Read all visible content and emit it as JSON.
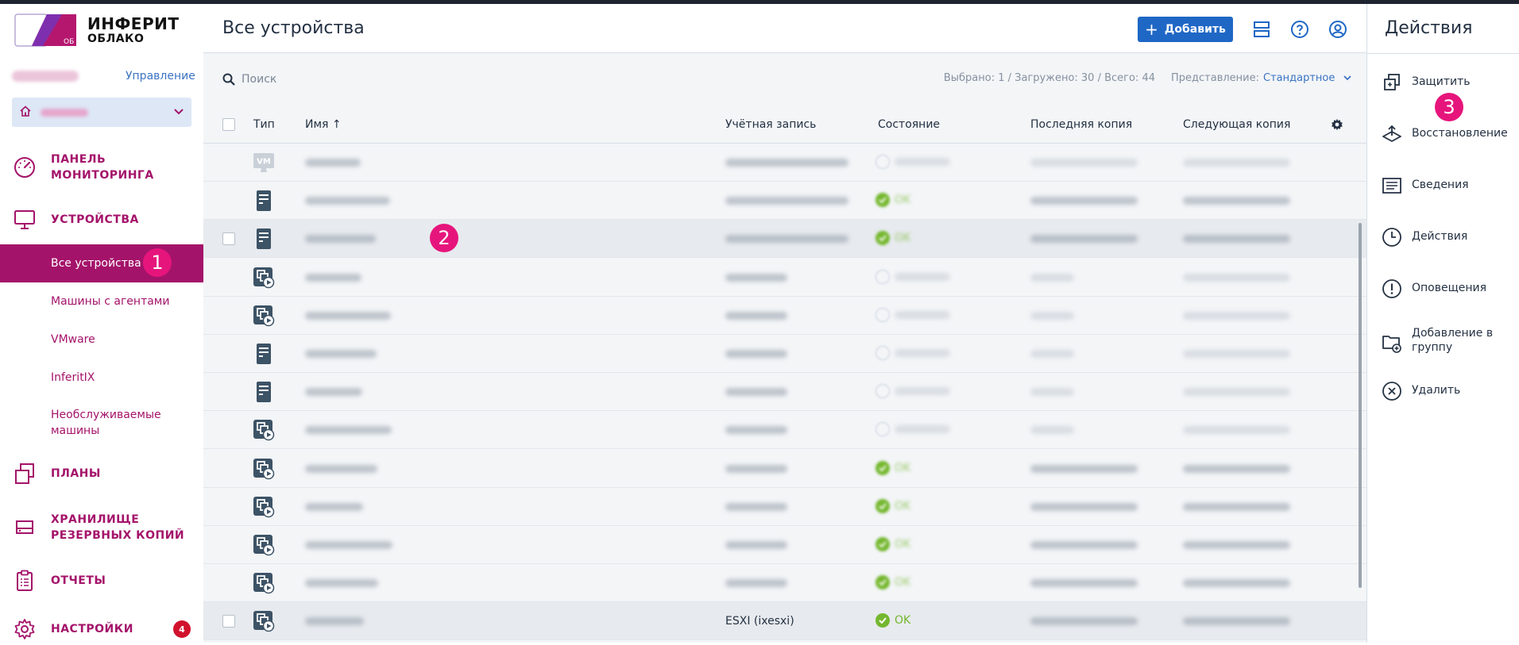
{
  "brand": {
    "logo_badge": "ОБ",
    "name_line1": "ИНФЕРИТ",
    "name_line2": "ОБЛАКО",
    "accent_color": "#a4136a",
    "primary_color": "#1f67c5"
  },
  "sidebar": {
    "client_name": "",
    "manage_label": "Управление",
    "tenant_selected": "",
    "nav": [
      {
        "id": "dashboard",
        "label": "ПАНЕЛЬ МОНИТОРИНГА",
        "icon": "speedometer-icon"
      },
      {
        "id": "devices",
        "label": "УСТРОЙСТВА",
        "icon": "monitor-icon"
      },
      {
        "id": "plans",
        "label": "ПЛАНЫ",
        "icon": "plans-icon"
      },
      {
        "id": "storage",
        "label": "ХРАНИЛИЩЕ РЕЗЕРВНЫХ КОПИЙ",
        "icon": "storage-icon"
      },
      {
        "id": "reports",
        "label": "ОТЧЕТЫ",
        "icon": "clipboard-icon"
      },
      {
        "id": "settings",
        "label": "НАСТРОЙКИ",
        "icon": "gear-icon",
        "badge": "4"
      }
    ],
    "device_subitems": [
      {
        "label": "Все устройства",
        "active": true
      },
      {
        "label": "Машины с агентами",
        "active": false
      },
      {
        "label": "VMware",
        "active": false
      },
      {
        "label": "InferitIX",
        "active": false
      },
      {
        "label": "Необслуживаемые машины",
        "active": false
      }
    ]
  },
  "header": {
    "title": "Все устройства",
    "add_label": "Добавить"
  },
  "toolbar": {
    "search_placeholder": "Поиск",
    "counts": "Выбрано: 1 / Загружено: 30 / Всего: 44",
    "view_label": "Представление:",
    "view_value": "Стандартное"
  },
  "table": {
    "columns": {
      "type": "Тип",
      "name": "Имя ↑",
      "account": "Учётная запись",
      "state": "Состояние",
      "last_backup": "Последняя копия",
      "next_backup": "Следующая копия"
    },
    "rows": [
      {
        "icon": "vm-icon",
        "state": "none",
        "account": "",
        "last": "",
        "next": ""
      },
      {
        "icon": "server-icon",
        "state": "ok",
        "account": "",
        "last": "",
        "next": ""
      },
      {
        "icon": "server-icon",
        "state": "ok",
        "selected": true,
        "checkbox": true
      },
      {
        "icon": "vm-agent-icon",
        "state": "none"
      },
      {
        "icon": "vm-agent-icon",
        "state": "none"
      },
      {
        "icon": "server-icon",
        "state": "none"
      },
      {
        "icon": "server-icon",
        "state": "none"
      },
      {
        "icon": "vm-agent-icon",
        "state": "none"
      },
      {
        "icon": "vm-agent-icon",
        "state": "ok"
      },
      {
        "icon": "vm-agent-icon",
        "state": "ok"
      },
      {
        "icon": "vm-agent-icon",
        "state": "ok"
      },
      {
        "icon": "vm-agent-icon",
        "state": "ok"
      },
      {
        "icon": "vm-agent-icon",
        "state": "ok",
        "checkbox": true,
        "account": "ESXI (ixesxi)",
        "state_text": "OK",
        "visible": true
      }
    ],
    "vm_label": "VM",
    "ok_label": "OK"
  },
  "actions": {
    "title": "Действия",
    "items": [
      {
        "label": "Защитить",
        "icon": "protect-icon"
      },
      {
        "label": "Восстановление",
        "icon": "recover-icon"
      },
      {
        "label": "Сведения",
        "icon": "details-icon"
      },
      {
        "label": "Действия",
        "icon": "clock-icon"
      },
      {
        "label": "Оповещения",
        "icon": "alert-icon"
      },
      {
        "label": "Добавление в группу",
        "icon": "add-to-group-icon"
      },
      {
        "label": "Удалить",
        "icon": "delete-icon"
      }
    ]
  },
  "markers": [
    "1",
    "2",
    "3"
  ]
}
